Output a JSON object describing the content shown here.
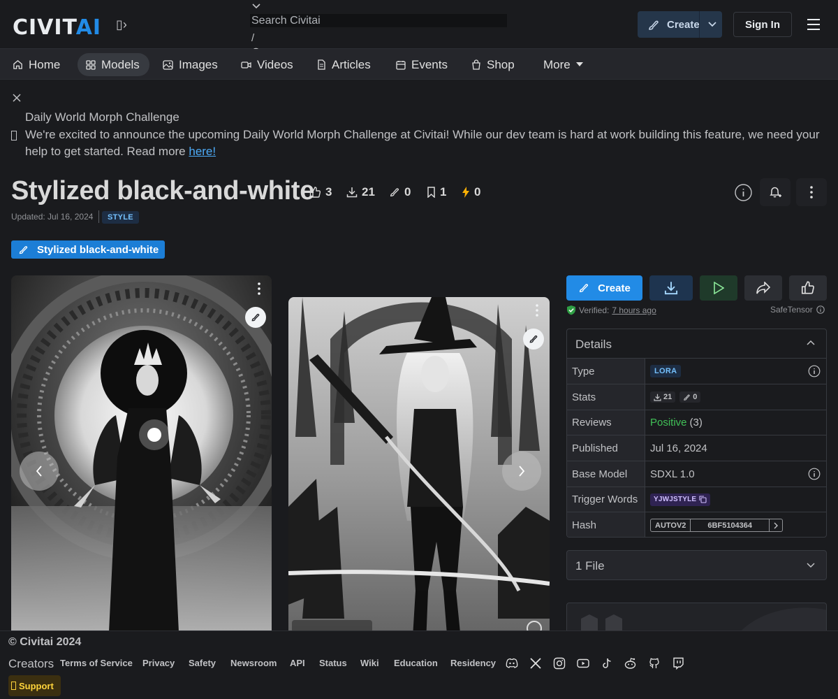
{
  "header": {
    "logo_main": "CIVIT",
    "logo_accent": "AI",
    "search_placeholder": "Search Civitai",
    "search_shortcut": "/",
    "create_label": "Create",
    "signin_label": "Sign In"
  },
  "nav": {
    "items": [
      {
        "label": "Home",
        "icon": "home-icon"
      },
      {
        "label": "Models",
        "icon": "grid-icon",
        "active": true
      },
      {
        "label": "Images",
        "icon": "image-icon"
      },
      {
        "label": "Videos",
        "icon": "video-icon"
      },
      {
        "label": "Articles",
        "icon": "document-icon"
      },
      {
        "label": "Events",
        "icon": "calendar-icon"
      },
      {
        "label": "Shop",
        "icon": "shopping-bag-icon"
      },
      {
        "label": "More",
        "icon": "caret-down-icon"
      }
    ]
  },
  "announcement": {
    "title": "Daily World Morph Challenge",
    "body": "We're excited to announce the upcoming Daily World Morph Challenge at Civitai! While our dev team is hard at work building this feature, we need your help to get started. Read more ",
    "link_text": "here!"
  },
  "model": {
    "title": "Stylized black-and-white",
    "stats": {
      "likes": "3",
      "downloads": "21",
      "generations": "0",
      "collections": "1",
      "buzz": "0"
    },
    "updated": "Updated: Jul 16, 2024",
    "style_badge": "STYLE",
    "version_label": "Stylized black-and-white"
  },
  "actions": {
    "create_label": "Create",
    "verified_prefix": "Verified:",
    "verified_time": "7 hours ago",
    "safetensor_label": "SafeTensor"
  },
  "details": {
    "title": "Details",
    "rows": {
      "type": {
        "key": "Type",
        "value": "LORA"
      },
      "stats": {
        "key": "Stats",
        "downloads": "21",
        "generations": "0"
      },
      "reviews": {
        "key": "Reviews",
        "value": "Positive",
        "count": "(3)"
      },
      "published": {
        "key": "Published",
        "value": "Jul 16, 2024"
      },
      "base_model": {
        "key": "Base Model",
        "value": "SDXL 1.0"
      },
      "trigger_words": {
        "key": "Trigger Words",
        "value": "YJWJSTYLE"
      },
      "hash": {
        "key": "Hash",
        "algo": "AUTOV2",
        "value": "6BF5104364"
      }
    }
  },
  "files": {
    "title": "1 File"
  },
  "footer": {
    "copyright": "© Civitai 2024",
    "creators": "Creators",
    "links": [
      "Terms of Service",
      "Privacy",
      "Safety",
      "Newsroom",
      "API",
      "Status",
      "Wiki",
      "Education",
      "Residency"
    ],
    "support": "Support"
  },
  "colors": {
    "accent": "#228be6",
    "background": "#1a1b1e",
    "positive": "#40c057"
  }
}
